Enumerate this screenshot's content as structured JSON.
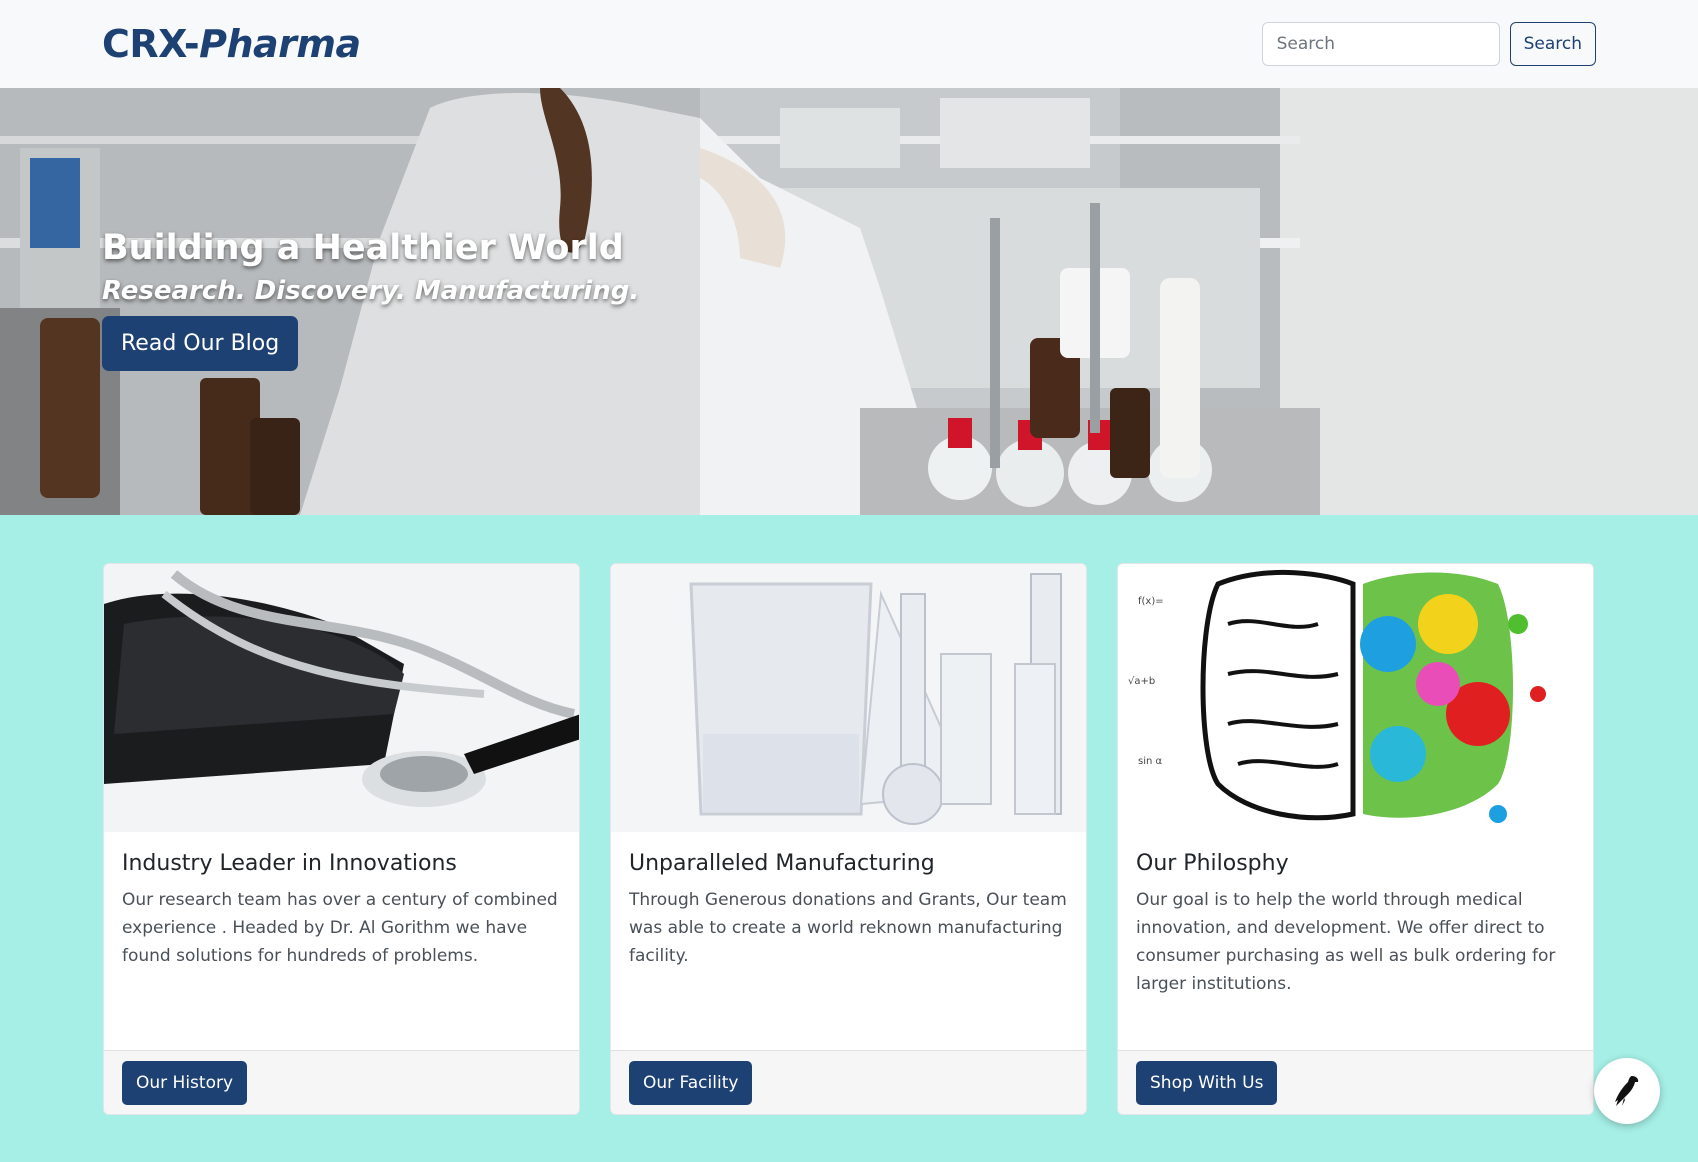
{
  "navbar": {
    "brand_prefix": "CRX-",
    "brand_suffix": "Pharma",
    "search_placeholder": "Search",
    "search_button": "Search"
  },
  "hero": {
    "title": "Building a Healthier World",
    "subtitle": "Research. Discovery. Manufacturing.",
    "button": "Read Our Blog"
  },
  "cards": [
    {
      "title": "Industry Leader in Innovations",
      "text": "Our research team has over a century of combined experience . Headed by Dr. Al Gorithm we have found solutions for hundreds of problems.",
      "button": "Our History"
    },
    {
      "title": "Unparalleled Manufacturing",
      "text": "Through Generous donations and Grants, Our team was able to create a world reknown manufacturing facility.",
      "button": "Our Facility"
    },
    {
      "title": "Our Philosphy",
      "text": "Our goal is to help the world through medical innovation, and development. We offer direct to consumer purchasing as well as bulk ordering for larger institutions.",
      "button": "Shop With Us"
    }
  ],
  "colors": {
    "brand": "#1d4173",
    "page_background": "#a5efe6",
    "navbar_background": "#f8f9fa"
  },
  "icons": {
    "floating_button": "bird-icon"
  }
}
